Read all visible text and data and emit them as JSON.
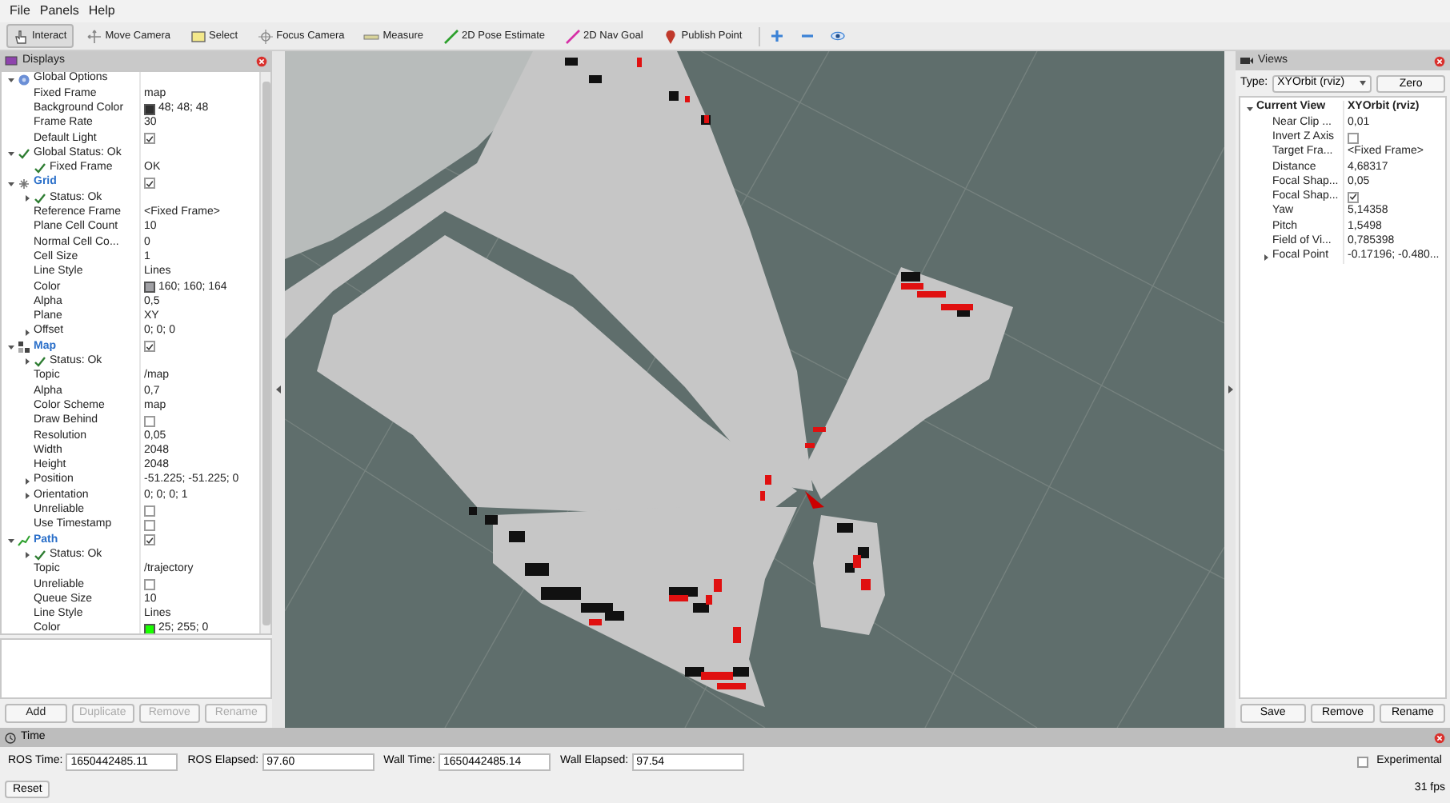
{
  "menu": [
    "File",
    "Panels",
    "Help"
  ],
  "toolbar": {
    "tools": [
      {
        "label": "Interact",
        "kind": "hand",
        "selected": true
      },
      {
        "label": "Move Camera",
        "kind": "move",
        "selected": false
      },
      {
        "label": "Select",
        "kind": "select",
        "selected": false
      },
      {
        "label": "Focus Camera",
        "kind": "focus",
        "selected": false
      },
      {
        "label": "Measure",
        "kind": "measure",
        "selected": false
      },
      {
        "label": "2D Pose Estimate",
        "kind": "pose",
        "selected": false
      },
      {
        "label": "2D Nav Goal",
        "kind": "goal",
        "selected": false
      },
      {
        "label": "Publish Point",
        "kind": "pin",
        "selected": false
      }
    ]
  },
  "displays": {
    "title": "Displays",
    "tree": [
      {
        "label": "Global Options",
        "kind": "gear",
        "expanded": true,
        "children": [
          {
            "label": "Fixed Frame",
            "value": "map"
          },
          {
            "label": "Background Color",
            "color": "#303030",
            "value": "48; 48; 48"
          },
          {
            "label": "Frame Rate",
            "value": "30"
          },
          {
            "label": "Default Light",
            "checked": true
          }
        ]
      },
      {
        "label": "Global Status: Ok",
        "kind": "ok",
        "expanded": true,
        "children": [
          {
            "label": "Fixed Frame",
            "kind": "ok",
            "value": "OK"
          }
        ]
      },
      {
        "label": "Grid",
        "kind": "grid",
        "checked": true,
        "expanded": true,
        "children": [
          {
            "label": "Status: Ok",
            "kind": "ok",
            "expanded": false
          },
          {
            "label": "Reference Frame",
            "value": "<Fixed Frame>"
          },
          {
            "label": "Plane Cell Count",
            "value": "10"
          },
          {
            "label": "Normal Cell Co...",
            "value": "0"
          },
          {
            "label": "Cell Size",
            "value": "1"
          },
          {
            "label": "Line Style",
            "value": "Lines"
          },
          {
            "label": "Color",
            "color": "#a0a0a4",
            "value": "160; 160; 164"
          },
          {
            "label": "Alpha",
            "value": "0,5"
          },
          {
            "label": "Plane",
            "value": "XY"
          },
          {
            "label": "Offset",
            "value": "0; 0; 0",
            "expanded": false
          }
        ]
      },
      {
        "label": "Map",
        "kind": "map",
        "checked": true,
        "expanded": true,
        "children": [
          {
            "label": "Status: Ok",
            "kind": "ok",
            "expanded": false
          },
          {
            "label": "Topic",
            "value": "/map"
          },
          {
            "label": "Alpha",
            "value": "0,7"
          },
          {
            "label": "Color Scheme",
            "value": "map"
          },
          {
            "label": "Draw Behind",
            "checked": false
          },
          {
            "label": "Resolution",
            "value": "0,05"
          },
          {
            "label": "Width",
            "value": "2048"
          },
          {
            "label": "Height",
            "value": "2048"
          },
          {
            "label": "Position",
            "value": "-51.225; -51.225; 0",
            "expanded": false
          },
          {
            "label": "Orientation",
            "value": "0; 0; 0; 1",
            "expanded": false
          },
          {
            "label": "Unreliable",
            "checked": false
          },
          {
            "label": "Use Timestamp",
            "checked": false
          }
        ]
      },
      {
        "label": "Path",
        "kind": "path",
        "checked": true,
        "expanded": true,
        "children": [
          {
            "label": "Status: Ok",
            "kind": "ok",
            "expanded": false
          },
          {
            "label": "Topic",
            "value": "/trajectory"
          },
          {
            "label": "Unreliable",
            "checked": false
          },
          {
            "label": "Queue Size",
            "value": "10"
          },
          {
            "label": "Line Style",
            "value": "Lines"
          },
          {
            "label": "Color",
            "color": "#19ff00",
            "value": "25; 255; 0"
          }
        ]
      }
    ],
    "buttons": [
      {
        "label": "Add",
        "disabled": false
      },
      {
        "label": "Duplicate",
        "disabled": true
      },
      {
        "label": "Remove",
        "disabled": true
      },
      {
        "label": "Rename",
        "disabled": true
      }
    ]
  },
  "views": {
    "title": "Views",
    "type_label": "Type:",
    "type_value": "XYOrbit (rviz)",
    "zero": "Zero",
    "tree": [
      {
        "label": "Current View",
        "value": "XYOrbit (rviz)",
        "expanded": true,
        "children": [
          {
            "label": "Near Clip ...",
            "value": "0,01"
          },
          {
            "label": "Invert Z Axis",
            "checked": false
          },
          {
            "label": "Target Fra...",
            "value": "<Fixed Frame>"
          },
          {
            "label": "Distance",
            "value": "4,68317"
          },
          {
            "label": "Focal Shap...",
            "value": "0,05"
          },
          {
            "label": "Focal Shap...",
            "checked": true
          },
          {
            "label": "Yaw",
            "value": "5,14358"
          },
          {
            "label": "Pitch",
            "value": "1,5498"
          },
          {
            "label": "Field of Vi...",
            "value": "0,785398"
          },
          {
            "label": "Focal Point",
            "value": "-0.17196; -0.480...",
            "expanded": false
          }
        ]
      }
    ],
    "buttons": [
      "Save",
      "Remove",
      "Rename"
    ]
  },
  "time": {
    "title": "Time",
    "fields": [
      {
        "label": "ROS Time:",
        "value": "1650442485.11"
      },
      {
        "label": "ROS Elapsed:",
        "value": "97.60"
      },
      {
        "label": "Wall Time:",
        "value": "1650442485.14"
      },
      {
        "label": "Wall Elapsed:",
        "value": "97.54"
      }
    ],
    "experimental": {
      "label": "Experimental",
      "checked": false
    },
    "reset": "Reset",
    "fps": "31 fps"
  }
}
